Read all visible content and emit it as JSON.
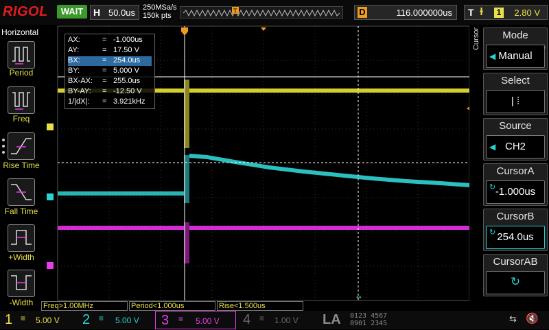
{
  "header": {
    "brand": "RIGOL",
    "run_status": "WAIT",
    "horizontal": {
      "label": "H",
      "timebase": "50.0us"
    },
    "sample_rate": "250MSa/s",
    "memory_depth": "150k pts",
    "delay": {
      "label": "D",
      "value": "116.000000us"
    },
    "trigger": {
      "label": "T",
      "channel": "1",
      "level": "2.80 V"
    }
  },
  "left_panel": {
    "title": "Horizontal",
    "buttons": [
      {
        "label": "Period"
      },
      {
        "label": "Freq"
      },
      {
        "label": "Rise Time"
      },
      {
        "label": "Fall Time"
      },
      {
        "label": "+Width"
      },
      {
        "label": "-Width"
      }
    ]
  },
  "cursor_readout": {
    "rows": [
      {
        "key": "AX:",
        "eq": "=",
        "value": "-1.000us"
      },
      {
        "key": "AY:",
        "eq": "=",
        "value": "17.50 V"
      },
      {
        "key": "BX:",
        "eq": "=",
        "value": "254.0us"
      },
      {
        "key": "BY:",
        "eq": "=",
        "value": "5.000 V"
      },
      {
        "key": "BX-AX:",
        "eq": "=",
        "value": "255.0us"
      },
      {
        "key": "BY-AY:",
        "eq": "=",
        "value": "-12.50 V"
      },
      {
        "key": "1/|dX|:",
        "eq": "=",
        "value": "3.921kHz"
      }
    ]
  },
  "right_panel": {
    "menu_title": "Cursor",
    "mode": {
      "label": "Mode",
      "value": "Manual"
    },
    "select": {
      "label": "Select",
      "value": "|   ⁞"
    },
    "source": {
      "label": "Source",
      "value": "CH2"
    },
    "cursor_a": {
      "label": "CursorA",
      "value": "-1.000us"
    },
    "cursor_b": {
      "label": "CursorB",
      "value": "254.0us"
    },
    "cursor_ab": {
      "label": "CursorAB"
    }
  },
  "measurements": [
    {
      "label": "Freq>1.00MHz"
    },
    {
      "label": "Period<1.000us"
    },
    {
      "label": "Rise<1.500us"
    }
  ],
  "channels": [
    {
      "number": "1",
      "scale": "5.00 V",
      "color": "#e8e04a",
      "active": true
    },
    {
      "number": "2",
      "scale": "5.00 V",
      "color": "#2bd2d2",
      "active": true
    },
    {
      "number": "3",
      "scale": "5.00 V",
      "color": "#e83ce8",
      "active": true
    },
    {
      "number": "4",
      "scale": "1.00 V",
      "color": "#6a6a6a",
      "active": false
    }
  ],
  "la": {
    "label": "LA",
    "bits_top": "0123 4567",
    "bits_bottom": "8901 2345"
  },
  "colors": {
    "ch1": "#e8e04a",
    "ch2": "#2bd2d2",
    "ch3": "#e83ce8",
    "trigger_marker": "#f09a1e"
  }
}
